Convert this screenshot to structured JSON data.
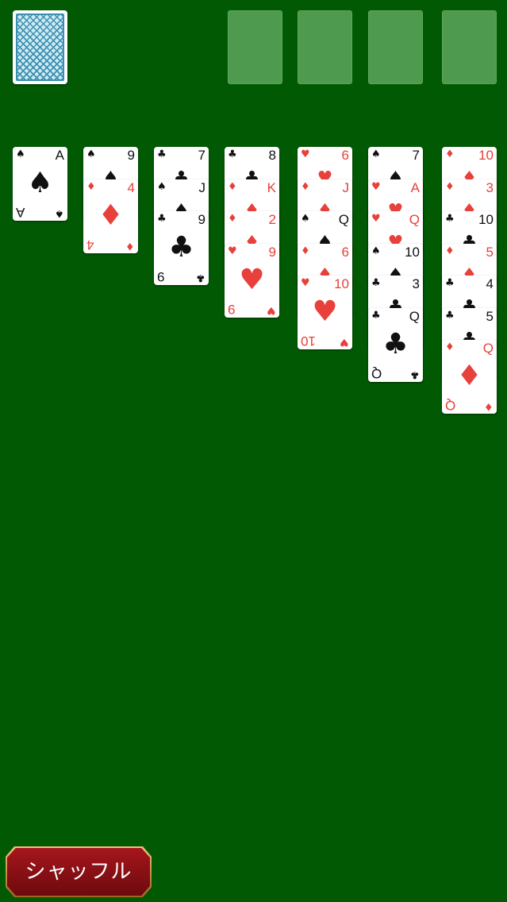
{
  "stock": {
    "icon": "card-back-icon"
  },
  "foundations": [
    {
      "label": ""
    },
    {
      "label": ""
    },
    {
      "label": ""
    },
    {
      "label": ""
    }
  ],
  "colors": {
    "table": "#015a03",
    "red_suit": "#e8403a",
    "black_suit": "#111111"
  },
  "tableau": [
    [
      {
        "rank": "A",
        "suit": "spades"
      }
    ],
    [
      {
        "rank": "9",
        "suit": "spades"
      },
      {
        "rank": "4",
        "suit": "diamonds"
      }
    ],
    [
      {
        "rank": "7",
        "suit": "clubs"
      },
      {
        "rank": "J",
        "suit": "spades"
      },
      {
        "rank": "9",
        "suit": "clubs"
      }
    ],
    [
      {
        "rank": "8",
        "suit": "clubs"
      },
      {
        "rank": "K",
        "suit": "diamonds"
      },
      {
        "rank": "2",
        "suit": "diamonds"
      },
      {
        "rank": "9",
        "suit": "hearts"
      }
    ],
    [
      {
        "rank": "6",
        "suit": "hearts"
      },
      {
        "rank": "J",
        "suit": "diamonds"
      },
      {
        "rank": "Q",
        "suit": "spades"
      },
      {
        "rank": "6",
        "suit": "diamonds"
      },
      {
        "rank": "10",
        "suit": "hearts"
      }
    ],
    [
      {
        "rank": "7",
        "suit": "spades"
      },
      {
        "rank": "A",
        "suit": "hearts"
      },
      {
        "rank": "Q",
        "suit": "hearts"
      },
      {
        "rank": "10",
        "suit": "spades"
      },
      {
        "rank": "3",
        "suit": "clubs"
      },
      {
        "rank": "Q",
        "suit": "clubs"
      }
    ],
    [
      {
        "rank": "10",
        "suit": "diamonds"
      },
      {
        "rank": "3",
        "suit": "diamonds"
      },
      {
        "rank": "10",
        "suit": "clubs"
      },
      {
        "rank": "5",
        "suit": "diamonds"
      },
      {
        "rank": "4",
        "suit": "clubs"
      },
      {
        "rank": "5",
        "suit": "clubs"
      },
      {
        "rank": "Q",
        "suit": "diamonds"
      }
    ]
  ],
  "buttons": {
    "shuffle_label": "シャッフル"
  }
}
